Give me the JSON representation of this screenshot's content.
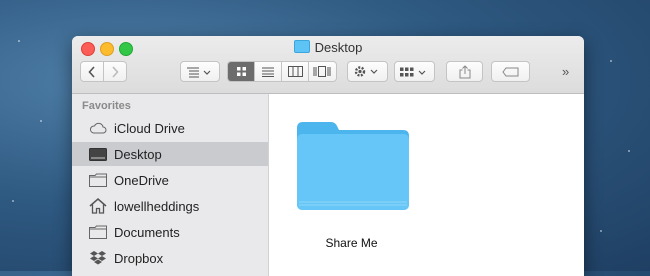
{
  "window": {
    "title": "Desktop",
    "overflow_label": "»"
  },
  "toolbar": {
    "back_icon": "chevron-left",
    "forward_icon": "chevron-right",
    "view_modes": [
      "icon-view",
      "list-view",
      "column-view",
      "cover-flow-view"
    ],
    "active_view": "icon-view"
  },
  "sidebar": {
    "section_title": "Favorites",
    "items": [
      {
        "label": "iCloud Drive",
        "icon": "cloud-icon"
      },
      {
        "label": "Desktop",
        "icon": "desktop-icon",
        "selected": true
      },
      {
        "label": "OneDrive",
        "icon": "folder-icon"
      },
      {
        "label": "lowellheddings",
        "icon": "home-icon"
      },
      {
        "label": "Documents",
        "icon": "folder-icon"
      },
      {
        "label": "Dropbox",
        "icon": "dropbox-icon"
      }
    ]
  },
  "content": {
    "items": [
      {
        "label": "Share Me",
        "icon": "folder-icon"
      }
    ]
  },
  "colors": {
    "folder_blue": "#5ec3f5",
    "selected_row": "#c9cbcf",
    "active_view_bg": "#6c6c6c"
  }
}
